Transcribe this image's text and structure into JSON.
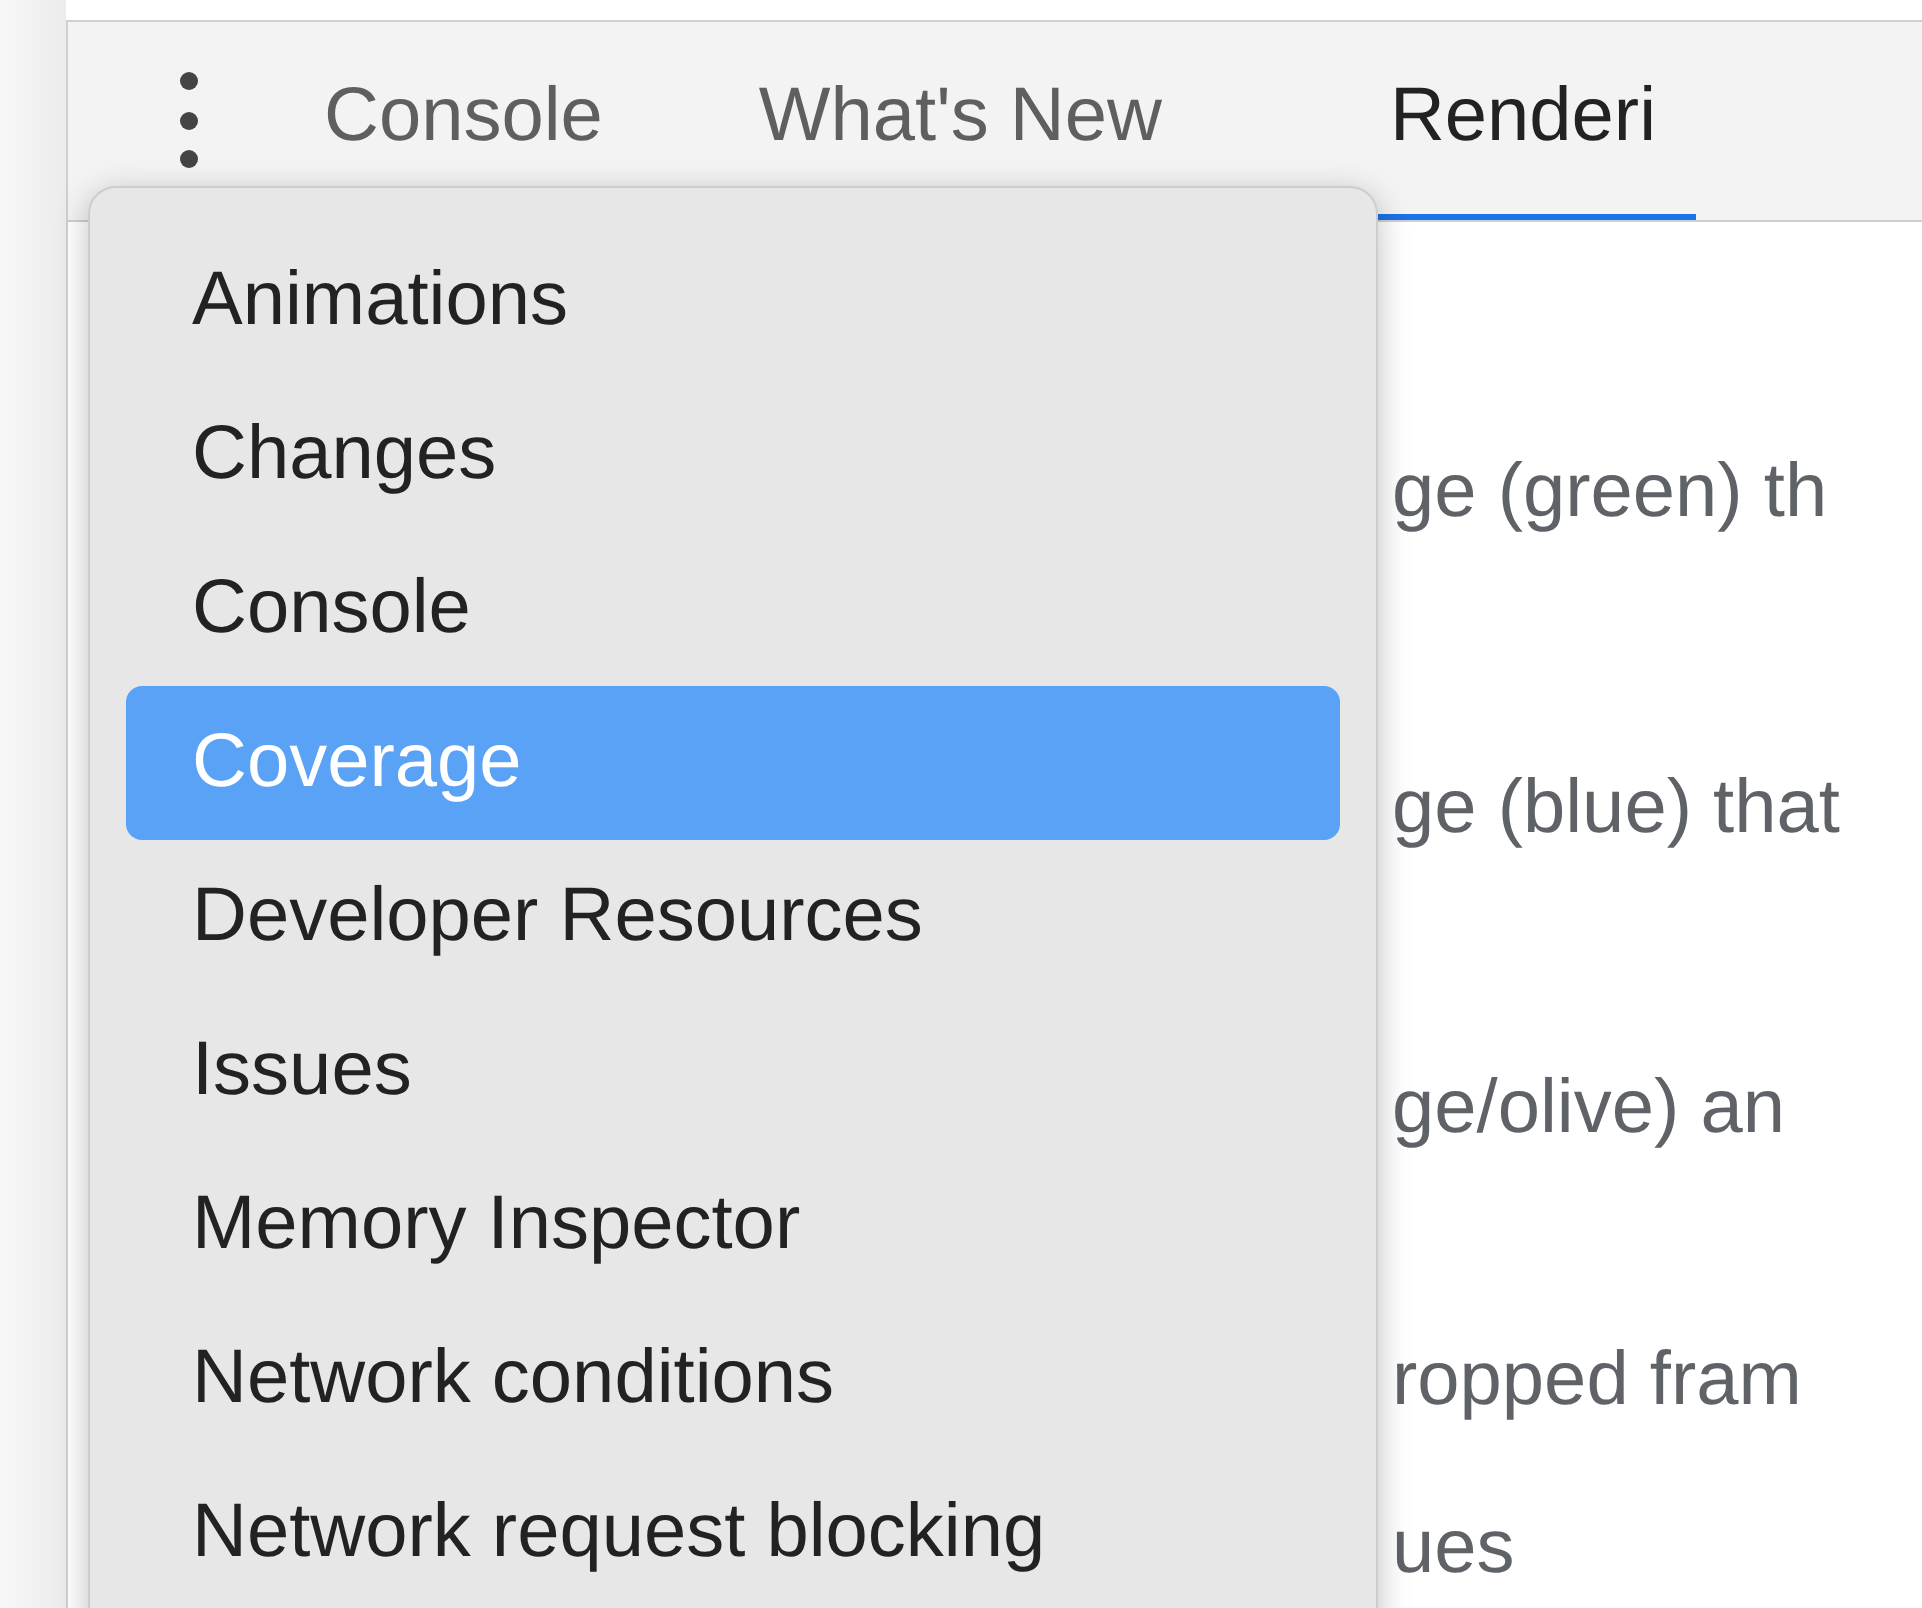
{
  "tabs": [
    {
      "label": "Console",
      "selected": false
    },
    {
      "label": "What's New",
      "selected": false
    },
    {
      "label": "Renderi",
      "selected": true
    }
  ],
  "content_lines": [
    "ge (green) th",
    "ge (blue) that",
    "ge/olive) an",
    "ropped fram",
    "ues"
  ],
  "menu": {
    "items": [
      {
        "label": "Animations",
        "selected": false
      },
      {
        "label": "Changes",
        "selected": false
      },
      {
        "label": "Console",
        "selected": false
      },
      {
        "label": "Coverage",
        "selected": true
      },
      {
        "label": "Developer Resources",
        "selected": false
      },
      {
        "label": "Issues",
        "selected": false
      },
      {
        "label": "Memory Inspector",
        "selected": false
      },
      {
        "label": "Network conditions",
        "selected": false
      },
      {
        "label": "Network request blocking",
        "selected": false
      }
    ]
  }
}
